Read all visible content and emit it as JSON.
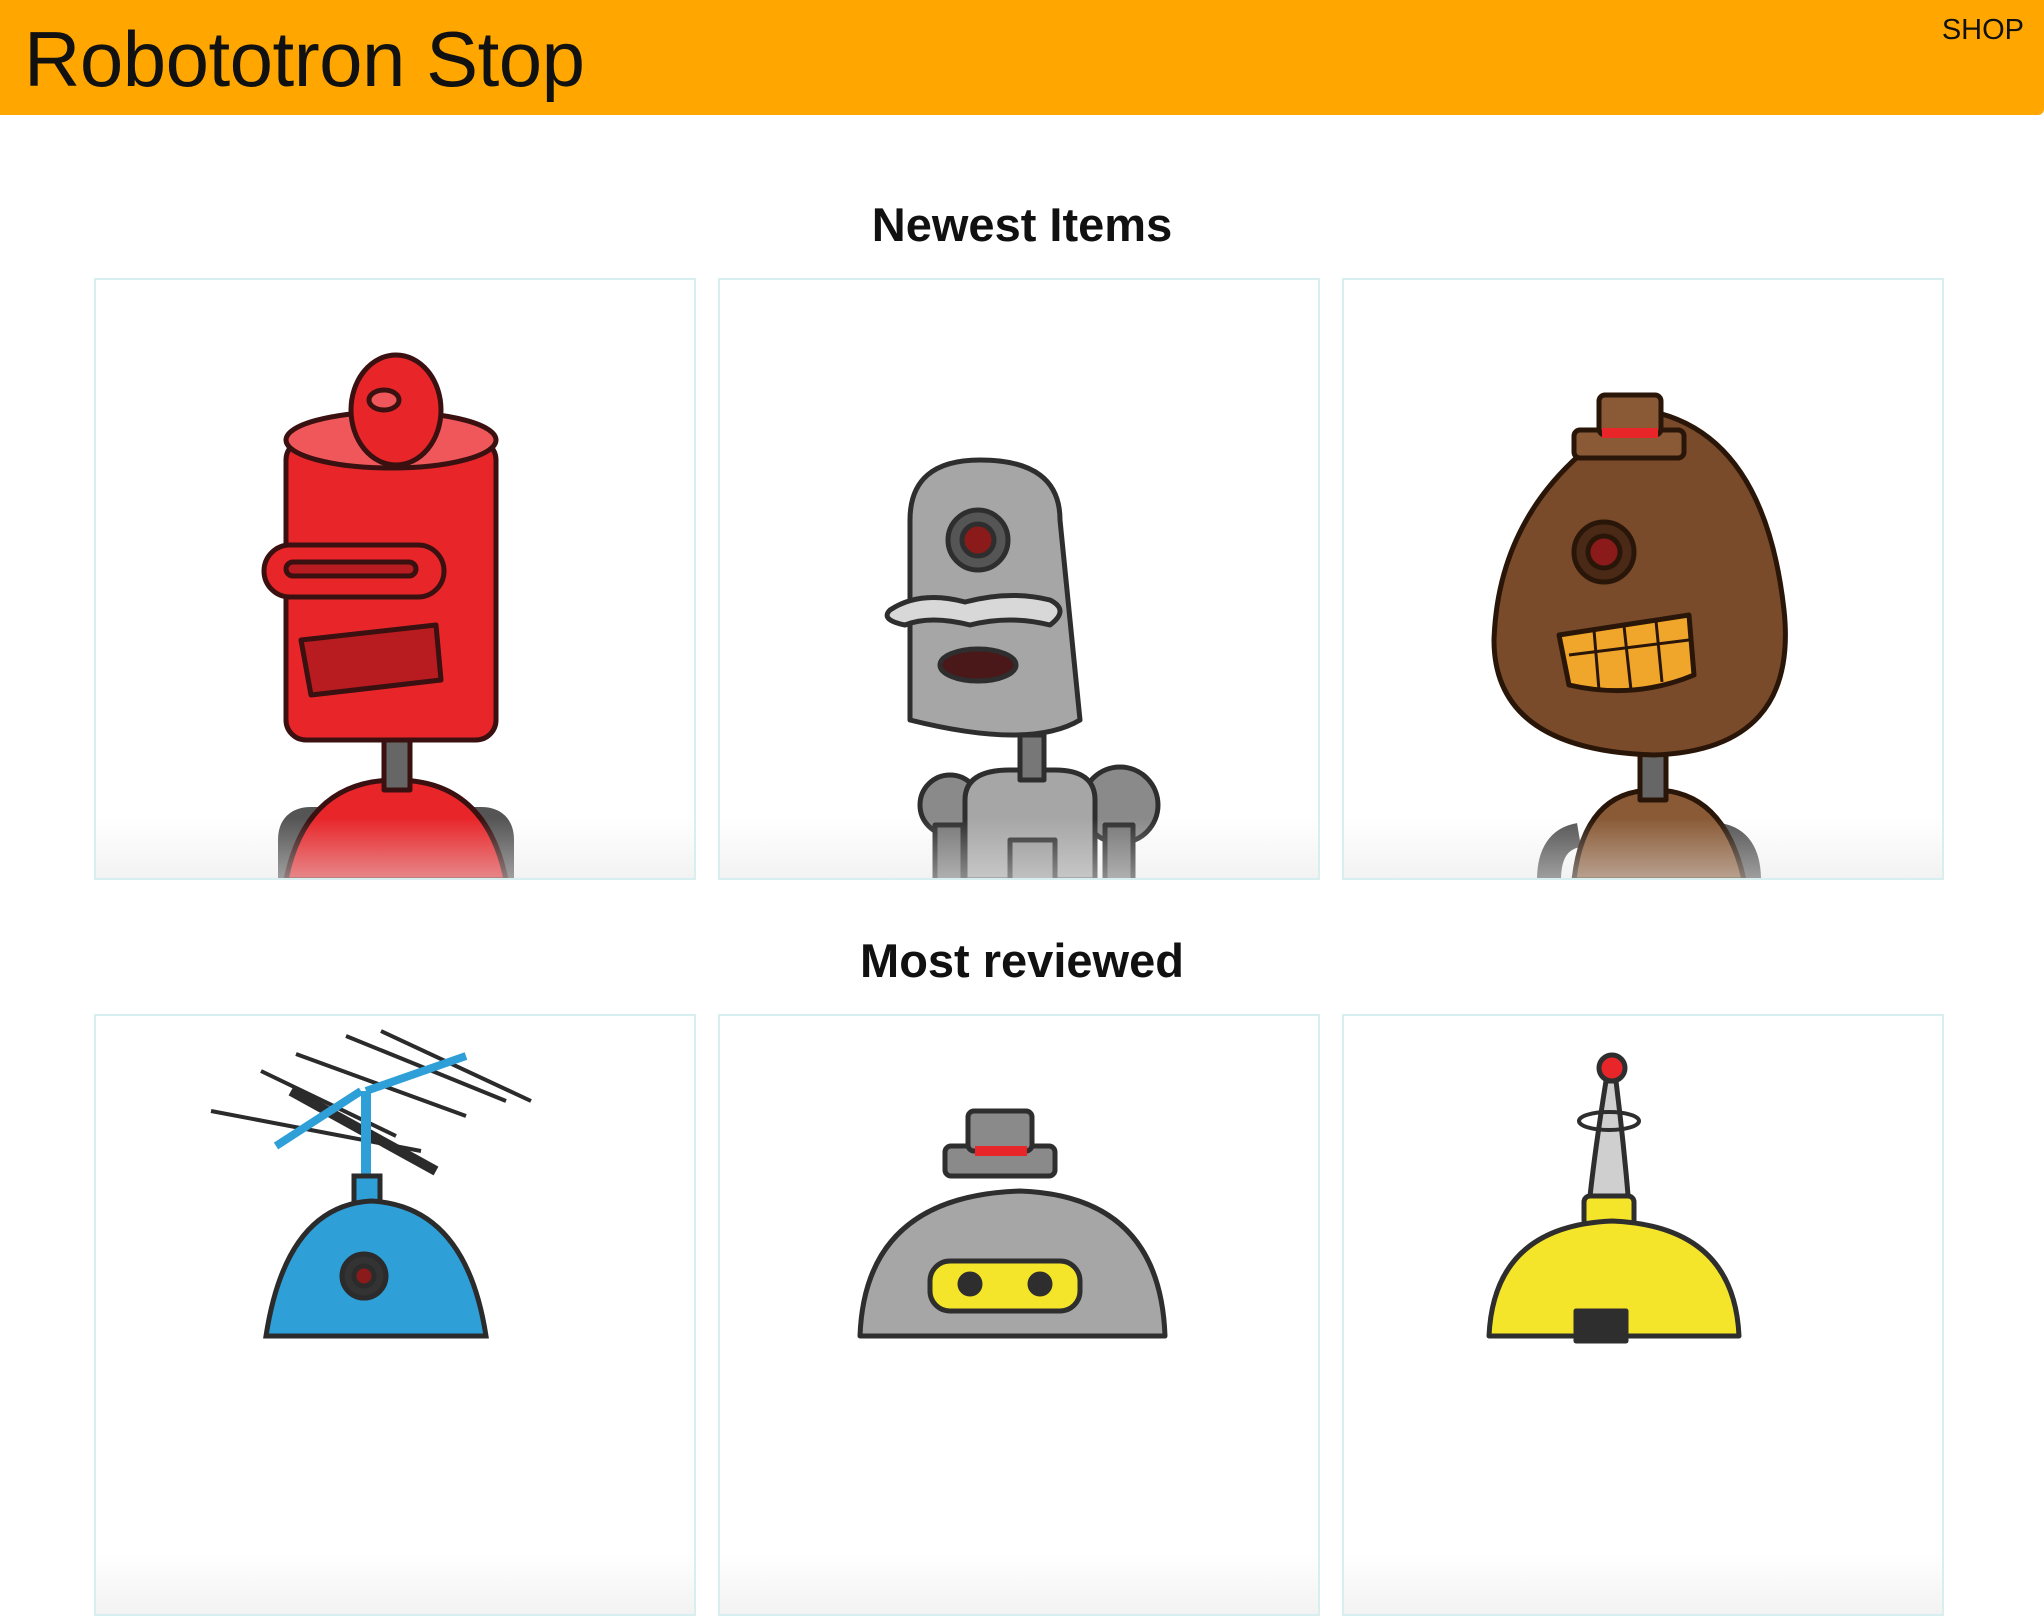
{
  "header": {
    "brand": "Robototron Stop",
    "shop_label": "SHOP",
    "background": "#ffa700"
  },
  "sections": [
    {
      "title": "Newest Items",
      "products": [
        {
          "icon": "red-robot-icon",
          "color": "#e8262a"
        },
        {
          "icon": "gray-robot-icon",
          "color": "#9a9a9a"
        },
        {
          "icon": "brown-robot-icon",
          "color": "#7a4b2a"
        }
      ]
    },
    {
      "title": "Most reviewed",
      "products": [
        {
          "icon": "blue-robot-icon",
          "color": "#2f9fd8"
        },
        {
          "icon": "gray-hat-robot-icon",
          "color": "#9a9a9a"
        },
        {
          "icon": "yellow-robot-icon",
          "color": "#f5e52a"
        }
      ]
    }
  ]
}
